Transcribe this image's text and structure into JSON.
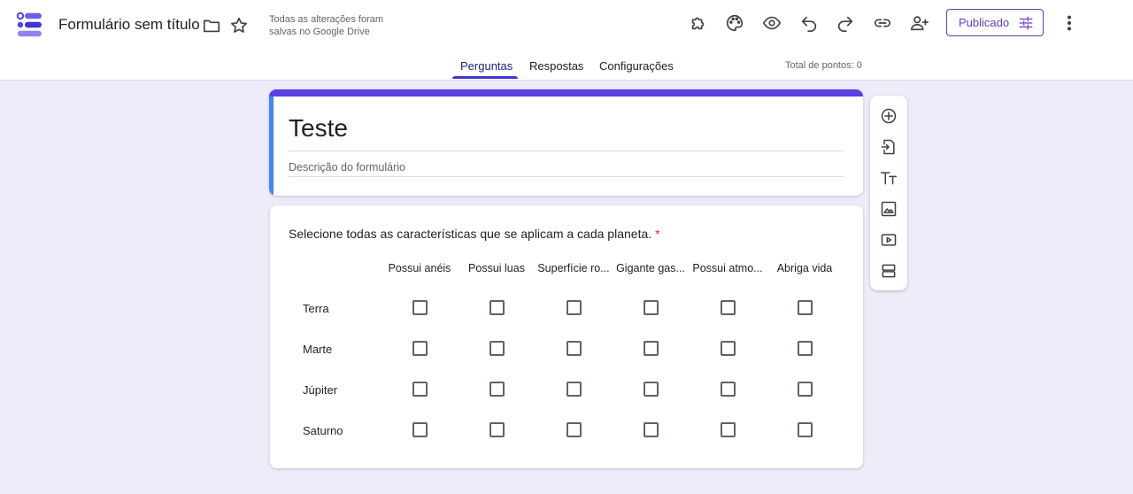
{
  "header": {
    "doc_title": "Formulário sem título",
    "save_status": "Todas as alterações foram salvas no Google Drive",
    "publish_label": "Publicado"
  },
  "icons": {
    "logo": "forms-logo-icon",
    "folder": "folder-icon",
    "star": "star-icon",
    "addons": "puzzle-icon",
    "theme": "palette-icon",
    "preview": "eye-icon",
    "undo": "undo-icon",
    "redo": "redo-icon",
    "link": "link-icon",
    "collaborators": "add-person-icon",
    "publish": "tune-icon",
    "more": "more-vert-icon"
  },
  "tabs": [
    {
      "label": "Perguntas",
      "active": true
    },
    {
      "label": "Respostas",
      "active": false
    },
    {
      "label": "Configurações",
      "active": false
    }
  ],
  "points_label": "Total de pontos: 0",
  "form": {
    "title": "Teste",
    "description_placeholder": "Descrição do formulário"
  },
  "question": {
    "text": "Selecione todas as características que se aplicam a cada planeta.",
    "required_mark": "*",
    "columns": [
      "Possui anéis",
      "Possui luas",
      "Superfície ro...",
      "Gigante gas...",
      "Possui atmo...",
      "Abriga vida"
    ],
    "rows": [
      "Terra",
      "Marte",
      "Júpiter",
      "Saturno"
    ]
  },
  "side_tools": [
    "add-question-icon",
    "import-icon",
    "title-text-icon",
    "image-icon",
    "video-icon",
    "section-icon"
  ],
  "colors": {
    "accent": "#673ab7",
    "header_bar": "#5b3fe0",
    "background": "#f0ebf8",
    "required": "#d93025"
  }
}
